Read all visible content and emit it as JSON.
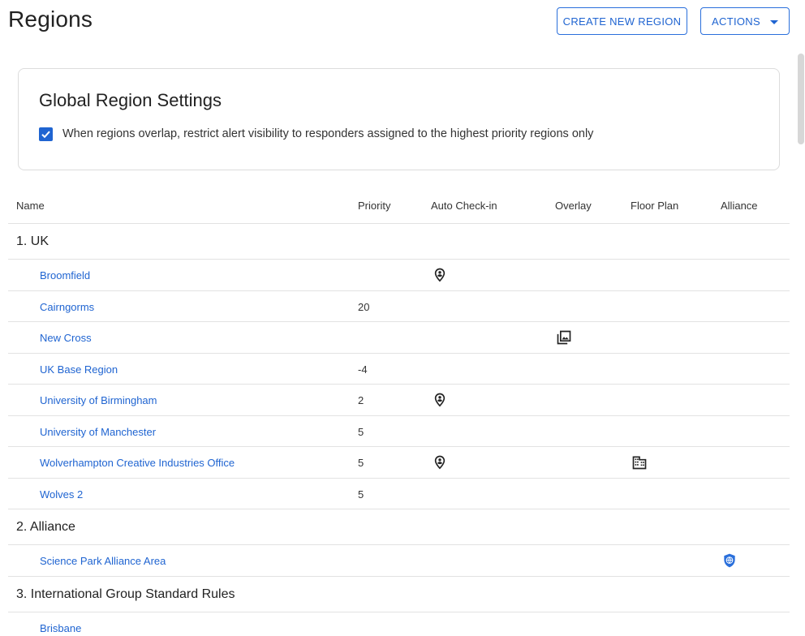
{
  "header": {
    "title": "Regions",
    "create_button": "CREATE NEW REGION",
    "actions_button": "ACTIONS"
  },
  "settings": {
    "title": "Global Region Settings",
    "checkbox_checked": true,
    "checkbox_label": "When regions overlap, restrict alert visibility to responders assigned to the highest priority regions only"
  },
  "table": {
    "columns": {
      "name": "Name",
      "priority": "Priority",
      "auto_checkin": "Auto Check-in",
      "overlay": "Overlay",
      "floor_plan": "Floor Plan",
      "alliance": "Alliance"
    },
    "groups": [
      {
        "label": "1. UK"
      },
      {
        "label": "2. Alliance"
      },
      {
        "label": "3. International Group Standard Rules"
      }
    ],
    "rows": [
      {
        "name": "Broomfield",
        "priority": "",
        "auto_checkin": true,
        "overlay": false,
        "floor_plan": false,
        "alliance": false
      },
      {
        "name": "Cairngorms",
        "priority": "20",
        "auto_checkin": false,
        "overlay": false,
        "floor_plan": false,
        "alliance": false
      },
      {
        "name": "New Cross",
        "priority": "",
        "auto_checkin": false,
        "overlay": true,
        "floor_plan": false,
        "alliance": false
      },
      {
        "name": "UK Base Region",
        "priority": "-4",
        "auto_checkin": false,
        "overlay": false,
        "floor_plan": false,
        "alliance": false
      },
      {
        "name": "University of Birmingham",
        "priority": "2",
        "auto_checkin": true,
        "overlay": false,
        "floor_plan": false,
        "alliance": false
      },
      {
        "name": "University of Manchester",
        "priority": "5",
        "auto_checkin": false,
        "overlay": false,
        "floor_plan": false,
        "alliance": false
      },
      {
        "name": "Wolverhampton Creative Industries Office",
        "priority": "5",
        "auto_checkin": true,
        "overlay": false,
        "floor_plan": true,
        "alliance": false
      },
      {
        "name": "Wolves 2",
        "priority": "5",
        "auto_checkin": false,
        "overlay": false,
        "floor_plan": false,
        "alliance": false
      },
      {
        "name": "Science Park Alliance Area",
        "priority": "",
        "auto_checkin": false,
        "overlay": false,
        "floor_plan": false,
        "alliance": true
      },
      {
        "name": "Brisbane",
        "priority": "",
        "auto_checkin": false,
        "overlay": false,
        "floor_plan": false,
        "alliance": false
      }
    ]
  },
  "icons": {
    "auto_checkin": "location-person-icon",
    "overlay": "image-stack-icon",
    "floor_plan": "building-icon",
    "alliance": "shield-globe-icon"
  },
  "colors": {
    "accent": "#1f64d1",
    "alliance_shield": "#2a6fdb"
  }
}
